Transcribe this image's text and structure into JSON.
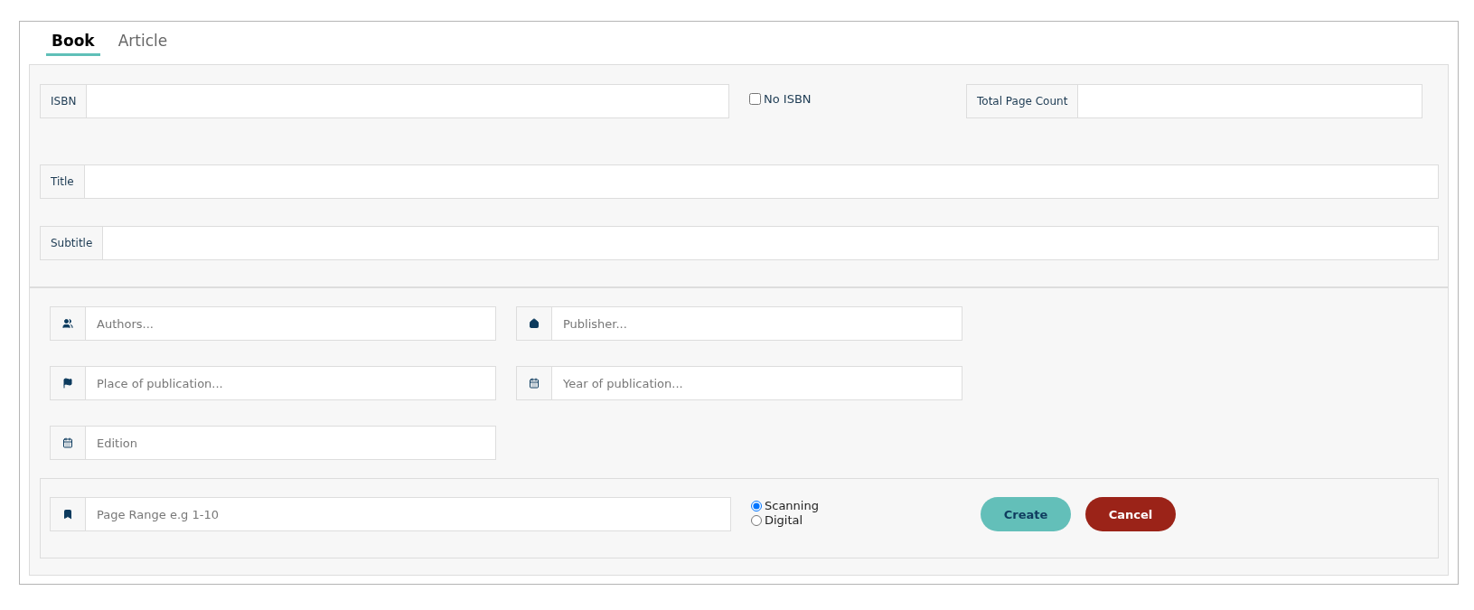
{
  "tabs": [
    {
      "label": "Book",
      "selected": true
    },
    {
      "label": "Article",
      "selected": false
    }
  ],
  "isbn": {
    "label": "ISBN"
  },
  "no_isbn": {
    "label": "No ISBN",
    "checked": false
  },
  "total_page_count": {
    "label": "Total Page Count"
  },
  "title": {
    "label": "Title"
  },
  "subtitle": {
    "label": "Subtitle"
  },
  "details": [
    {
      "placeholder": "Authors..."
    },
    {
      "placeholder": "Publisher..."
    },
    {
      "placeholder": "Place of publication..."
    },
    {
      "placeholder": "Year of publication..."
    },
    {
      "placeholder": "Edition"
    }
  ],
  "page_range": {
    "placeholder": "Page Range e.g 1-10"
  },
  "scan_type": [
    {
      "label": "Scanning",
      "selected": true
    },
    {
      "label": "Digital",
      "selected": false
    }
  ],
  "buttons": [
    {
      "label": "Create",
      "kind": "primary"
    },
    {
      "label": "Cancel",
      "kind": "danger"
    }
  ]
}
